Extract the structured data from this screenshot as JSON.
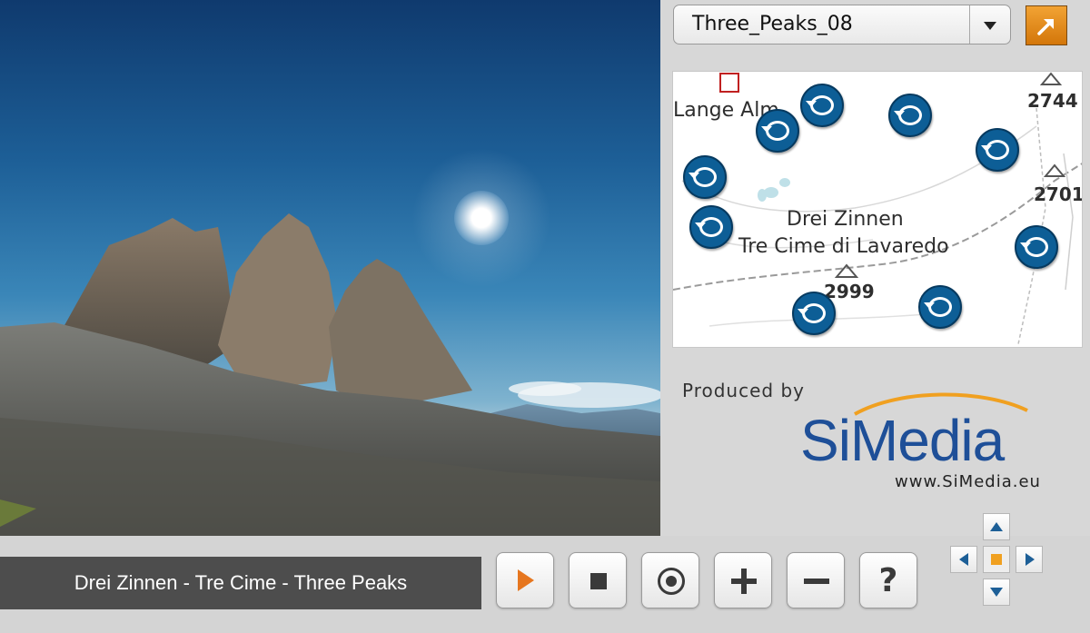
{
  "panorama": {
    "scene": "Three_Peaks_08"
  },
  "selector": {
    "selected": "Three_Peaks_08"
  },
  "map": {
    "labels": {
      "lange_alm": "Lange Alm",
      "drei_zinnen": "Drei Zinnen",
      "tre_cime": "Tre Cime di Lavaredo",
      "peak_2744": "2744",
      "peak_2701": "2701",
      "peak_2999": "2999"
    },
    "marker_icon": "panorama-rotate-icon"
  },
  "branding": {
    "produced_by": "Produced by",
    "logo_text": "SiMedia",
    "url": "www.SiMedia.eu"
  },
  "player": {
    "caption": "Drei Zinnen - Tre Cime - Three Peaks",
    "help_label": "?"
  },
  "colors": {
    "accent_orange": "#e6761f",
    "brand_blue": "#1e4f98",
    "marker_blue": "#0d5e96",
    "caption_bg": "#4d4d4d"
  }
}
